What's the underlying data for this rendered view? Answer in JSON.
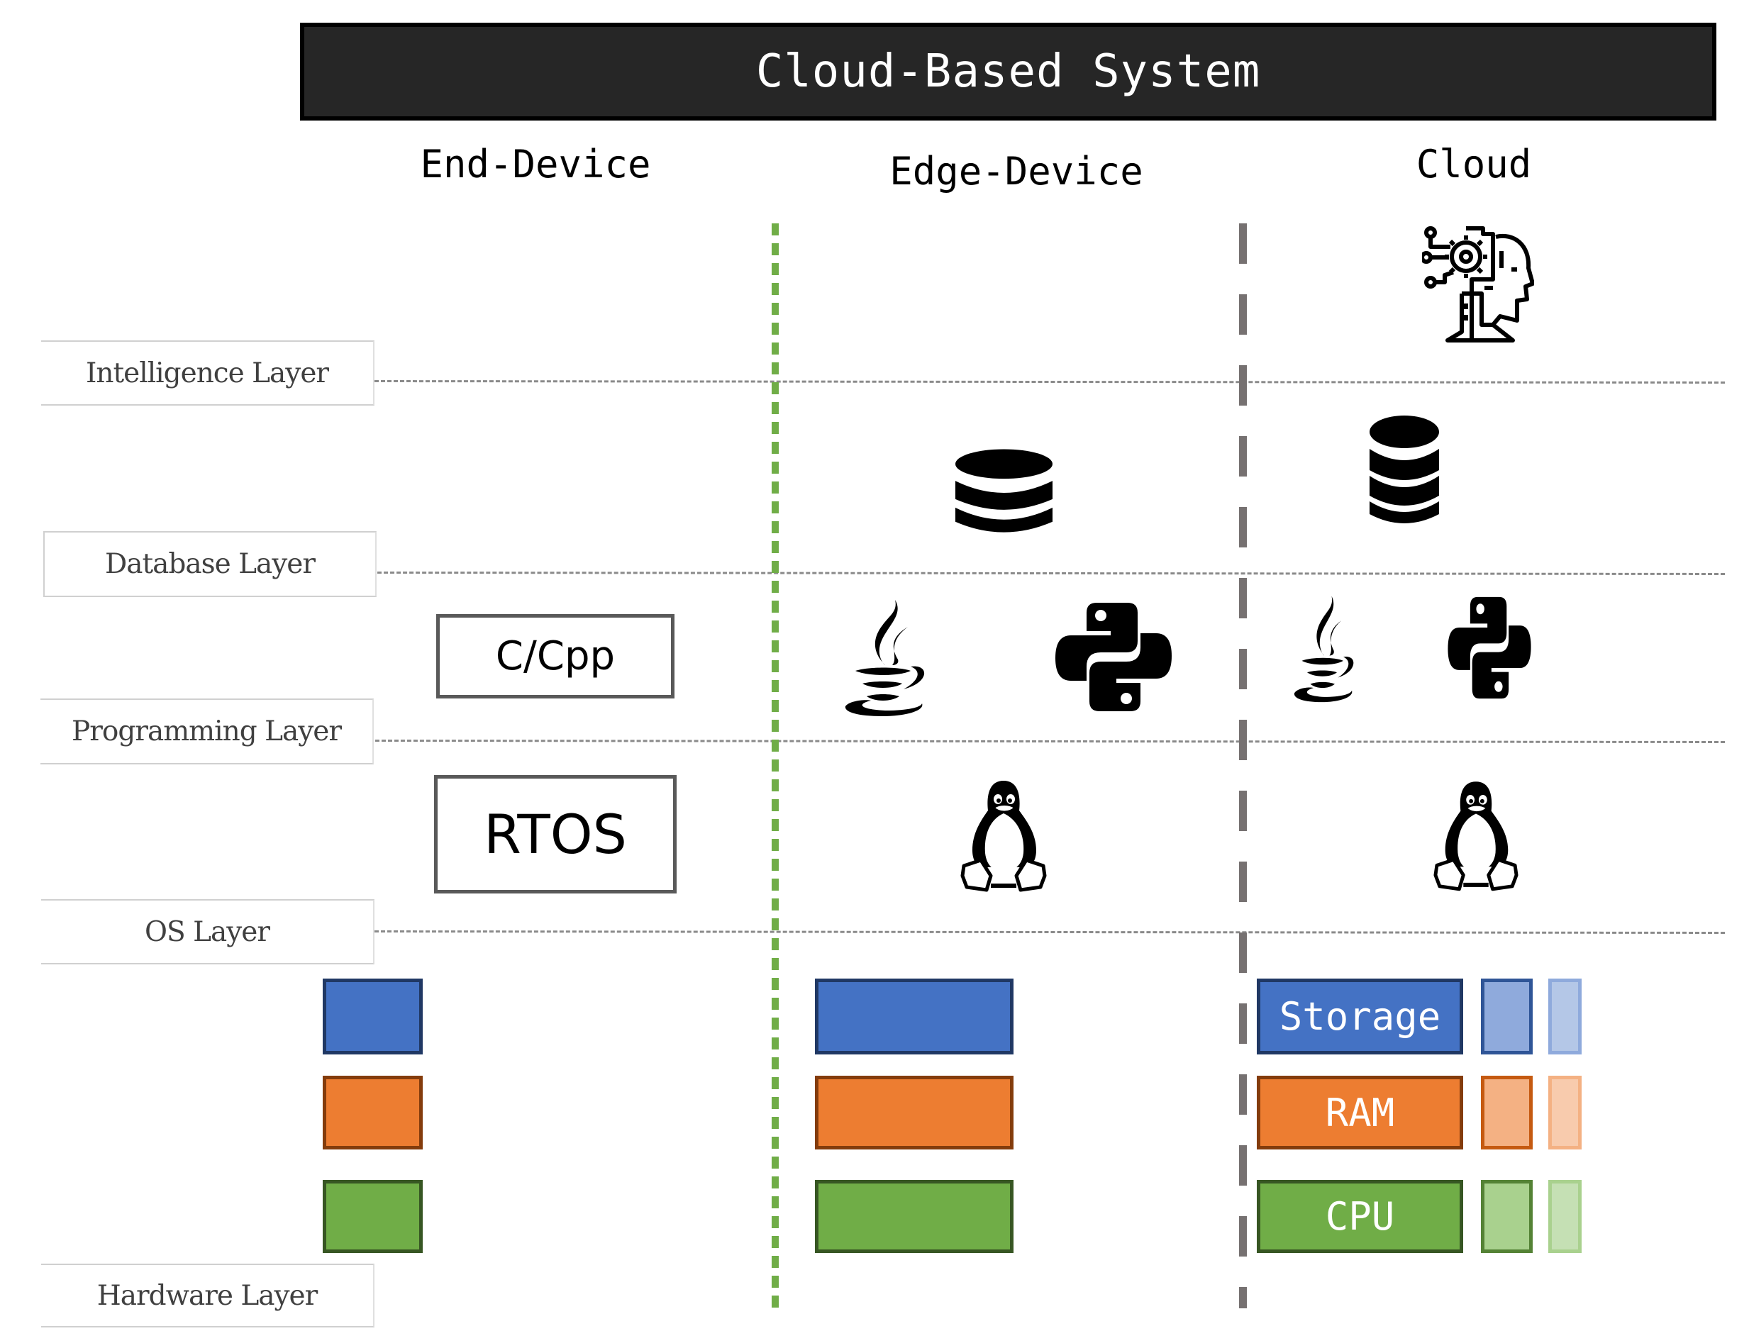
{
  "title": "Cloud-Based System",
  "columns": [
    {
      "key": "end_device",
      "label": "End-Device"
    },
    {
      "key": "edge_device",
      "label": "Edge-Device"
    },
    {
      "key": "cloud",
      "label": "Cloud"
    }
  ],
  "layers": [
    {
      "key": "intelligence",
      "label": "Intelligence Layer"
    },
    {
      "key": "database",
      "label": "Database Layer"
    },
    {
      "key": "programming",
      "label": "Programming Layer"
    },
    {
      "key": "os",
      "label": "OS Layer"
    },
    {
      "key": "hardware",
      "label": "Hardware Layer"
    }
  ],
  "end_device": {
    "programming": "C/Cpp",
    "os": "RTOS"
  },
  "edge_device": {
    "database_icon": "database-icon",
    "programming_icons": [
      "java-icon",
      "python-icon"
    ],
    "os_icon": "linux-penguin-icon"
  },
  "cloud": {
    "intelligence_icon": "ai-head-gear-icon",
    "database_icon": "database-icon",
    "programming_icons": [
      "java-icon",
      "python-icon"
    ],
    "os_icon": "linux-penguin-icon",
    "hardware_labels": {
      "storage": "Storage",
      "ram": "RAM",
      "cpu": "CPU"
    }
  },
  "dividers": {
    "end_edge": "green-dotted",
    "edge_cloud": "gray-dashed"
  },
  "colors": {
    "storage": "#4472c4",
    "ram": "#ed7d31",
    "cpu": "#70ad47",
    "title_bg": "#262626",
    "green_divider": "#70ad47",
    "gray_divider": "#767171"
  }
}
